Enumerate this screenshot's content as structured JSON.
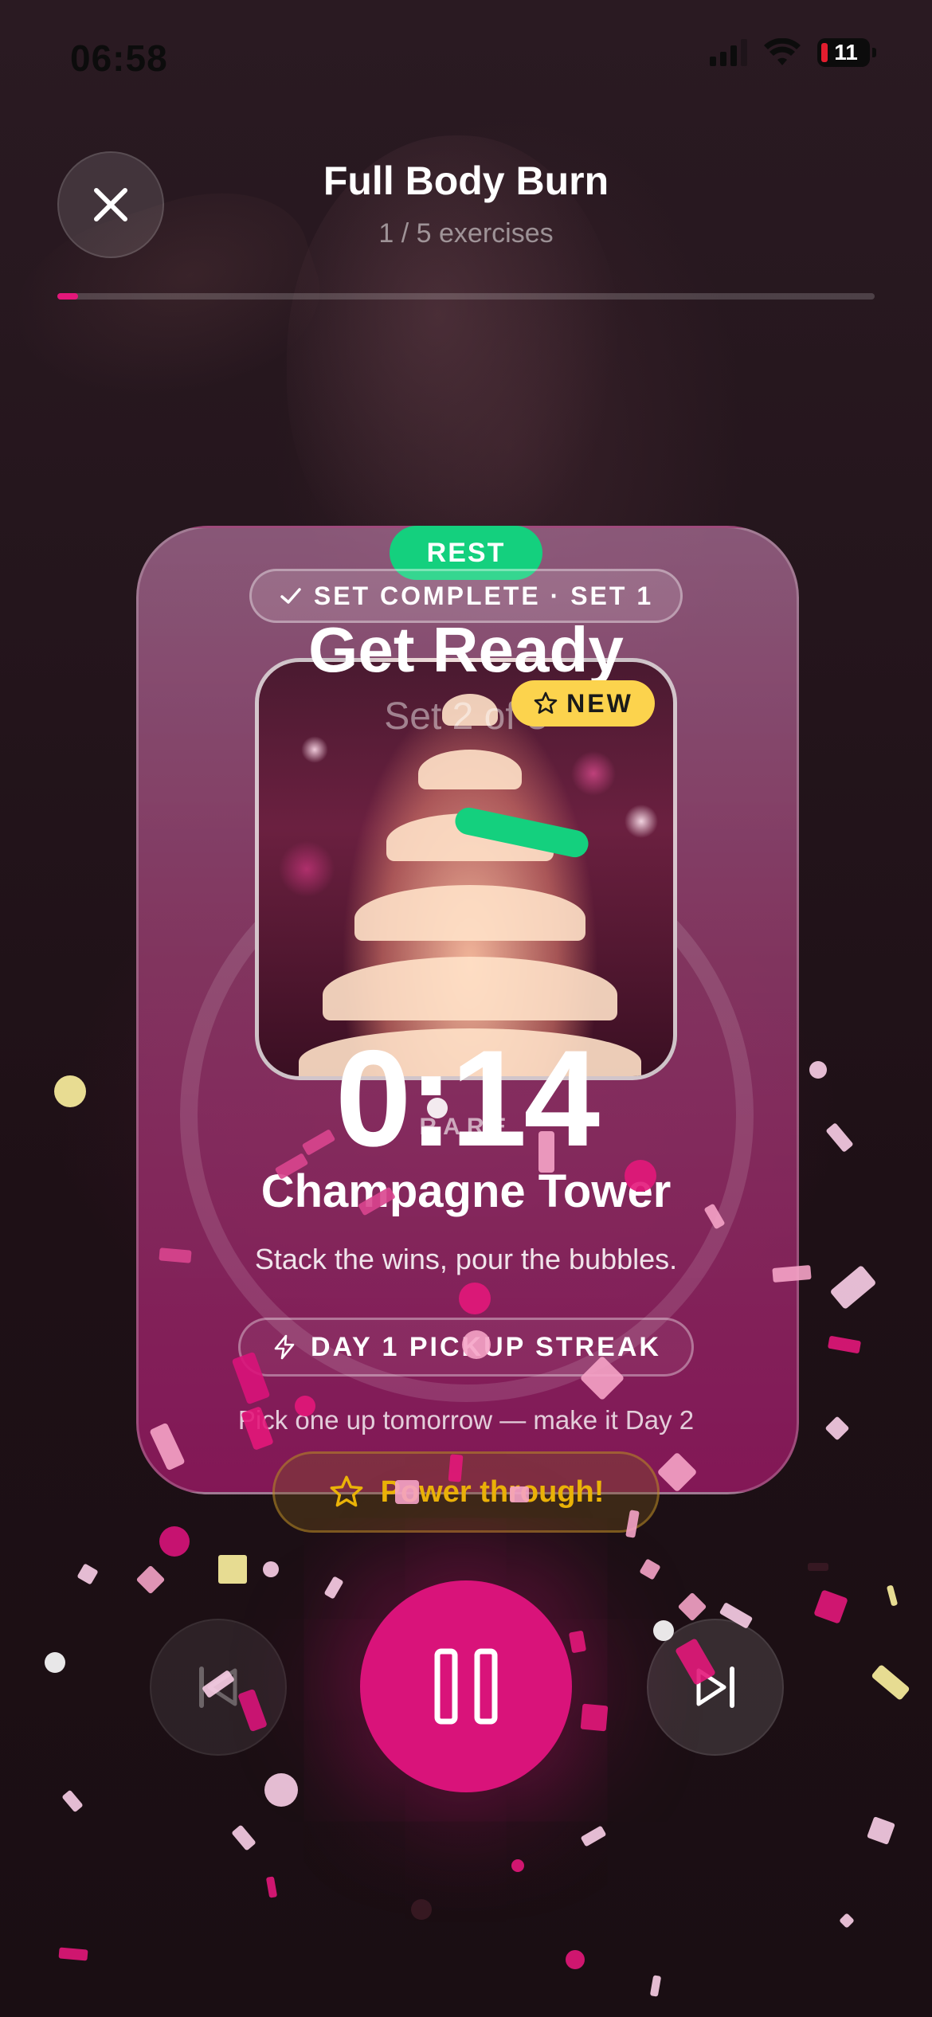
{
  "status_bar": {
    "time": "06:58",
    "battery": "11"
  },
  "header": {
    "title": "Full Body Burn",
    "subtitle": "1 / 5 exercises",
    "progress_fraction": 0.025
  },
  "card": {
    "phase_badge": "REST",
    "set_complete": "SET COMPLETE · SET 1",
    "heading": "Get Ready",
    "set_of": "Set 2 of 3",
    "new_badge": "NEW",
    "timer": "0:14",
    "rarity": "RARE",
    "reward_title": "Champagne Tower",
    "reward_desc": "Stack the wins, pour the bubbles.",
    "streak": "DAY 1 PICKUP STREAK",
    "streak_note": "Pick one up tomorrow — make it Day 2"
  },
  "power_button": {
    "label": "Power through!"
  },
  "controls": {
    "previous_icon": "skip-back-icon",
    "pause_icon": "pause-icon",
    "next_icon": "skip-forward-icon"
  },
  "colors": {
    "accent": "#d9137a",
    "rest_green": "#14d07e",
    "badge_yellow": "#fcd34d",
    "power_gold": "#eab308"
  }
}
